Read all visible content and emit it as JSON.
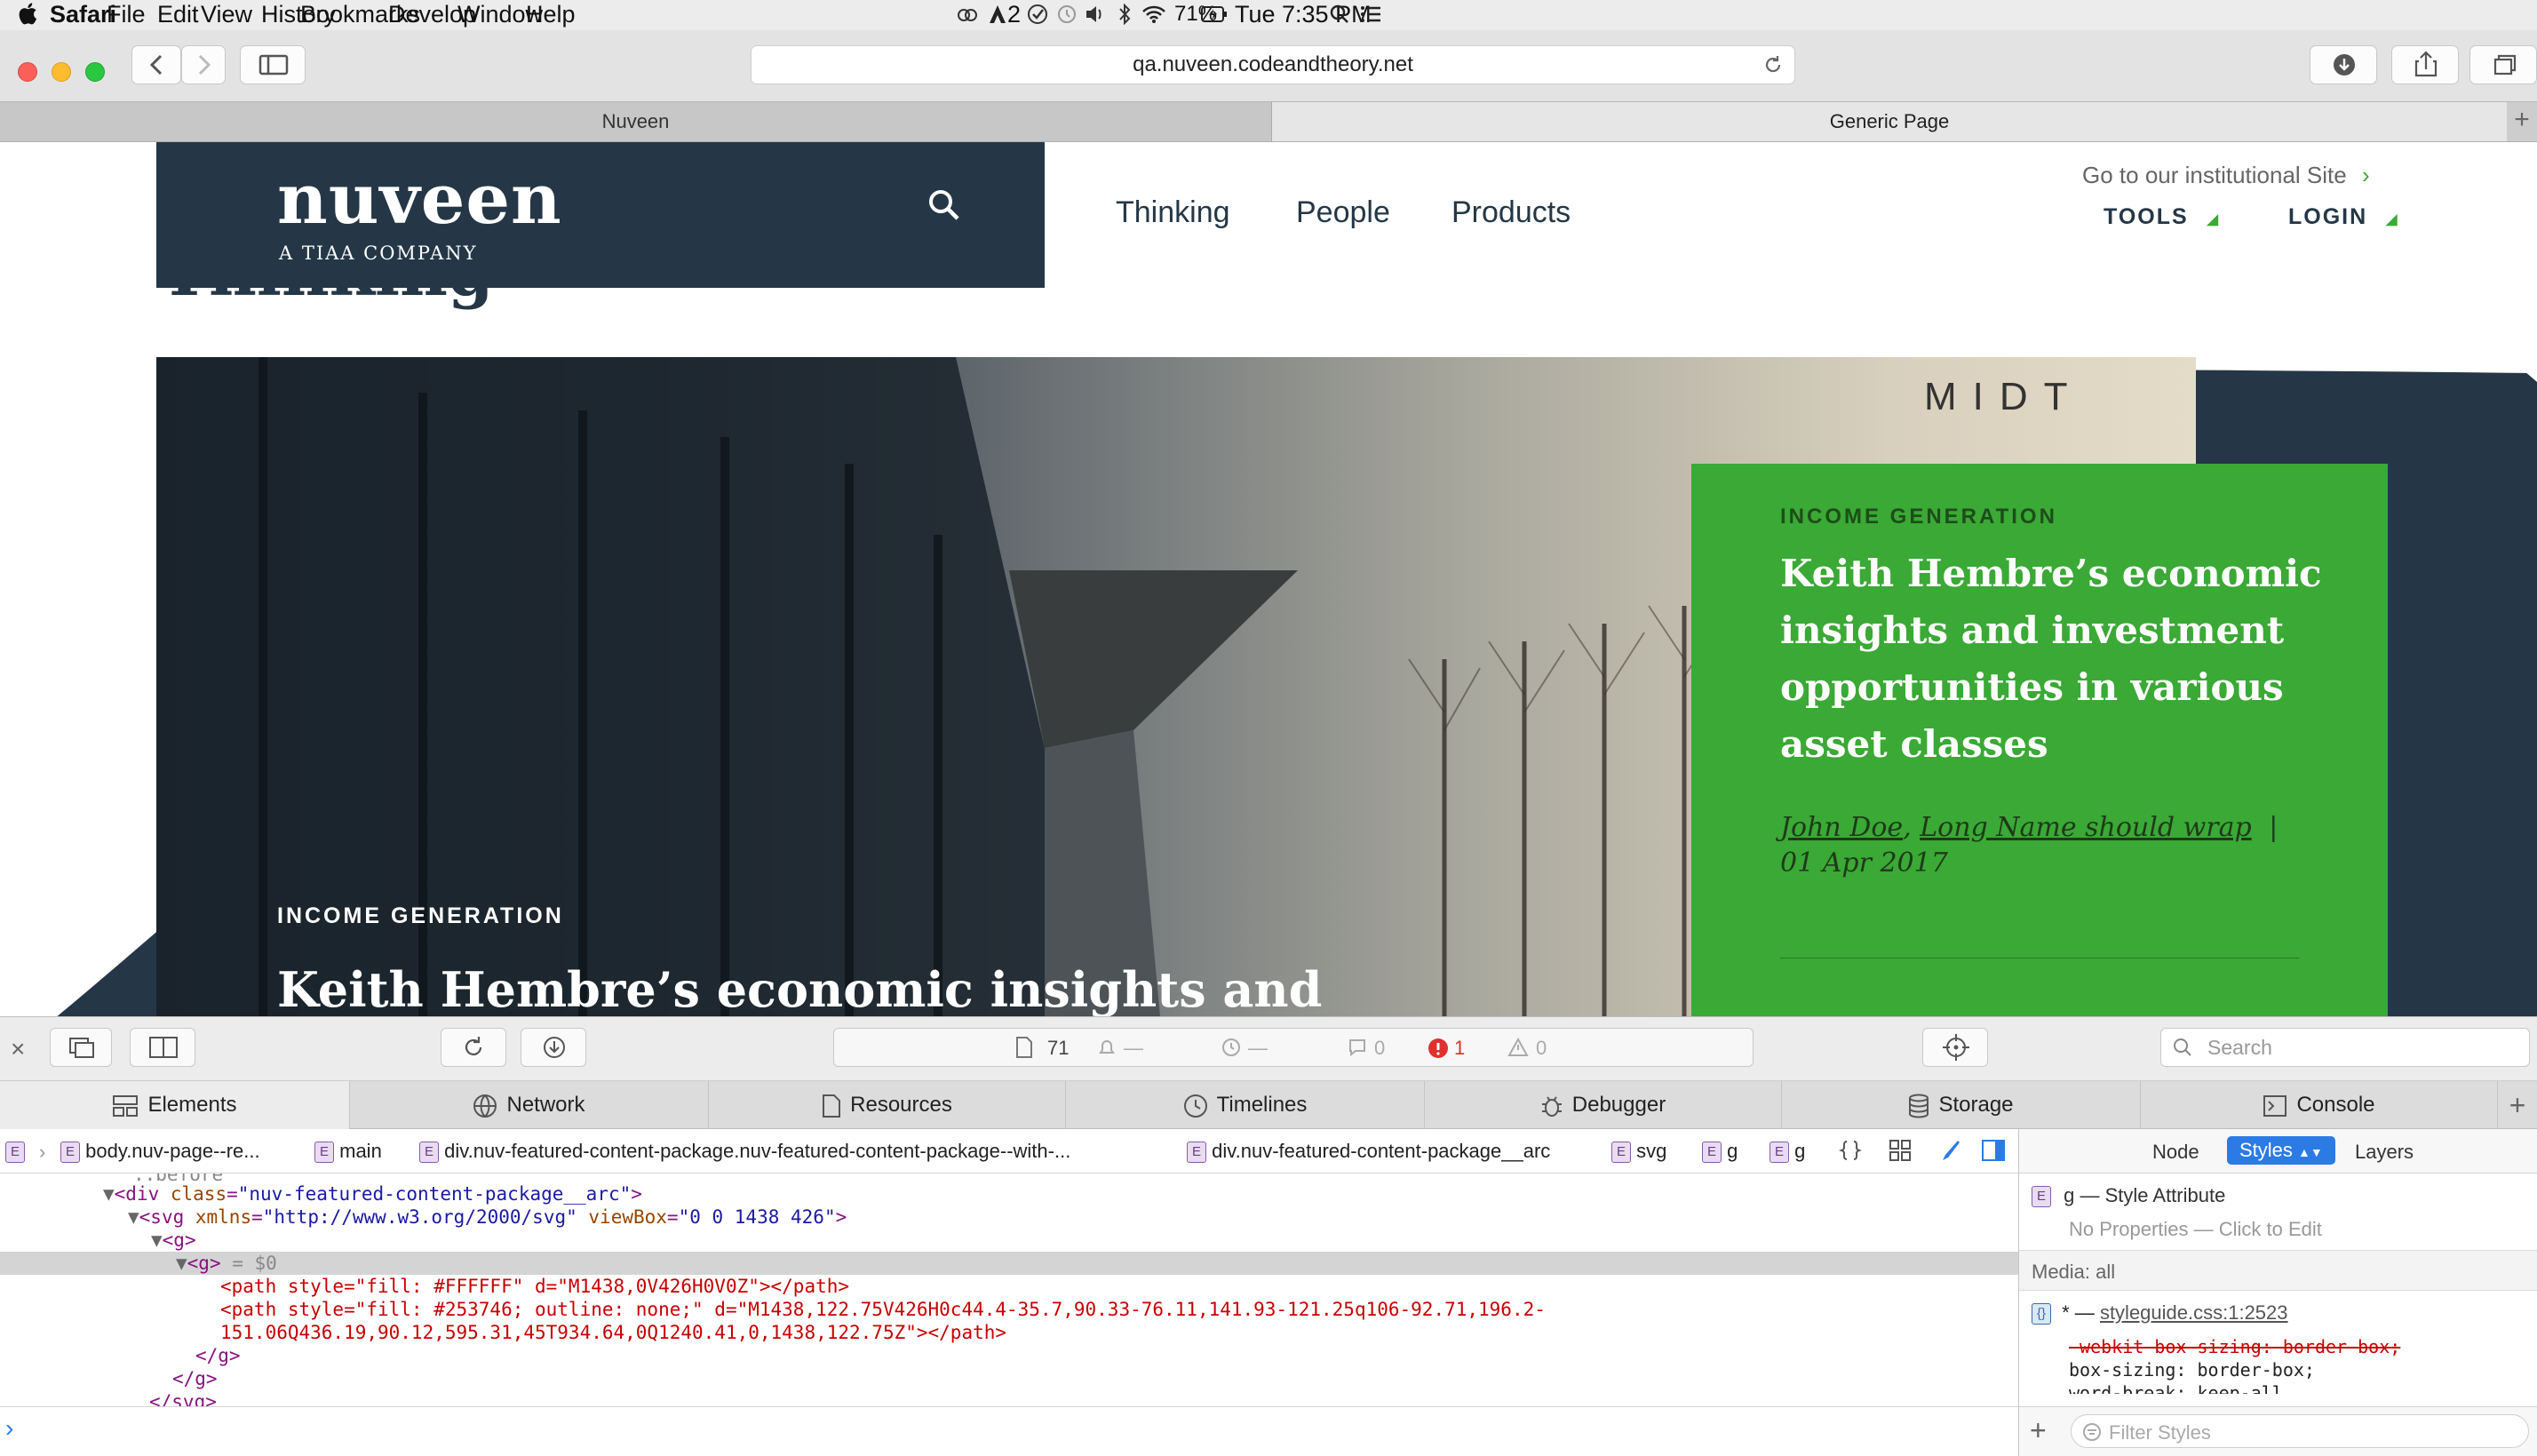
{
  "menubar": {
    "app": "Safari",
    "items": [
      "File",
      "Edit",
      "View",
      "History",
      "Bookmarks",
      "Develop",
      "Window",
      "Help"
    ],
    "status": {
      "adobe_count": "2",
      "battery": "71%",
      "clock": "Tue 7:35 PM"
    }
  },
  "browser": {
    "url": "qa.nuveen.codeandtheory.net",
    "tabs": [
      "Nuveen",
      "Generic Page"
    ]
  },
  "site": {
    "logo": "nuveen",
    "logo_tag": "A TIAA COMPANY",
    "nav": [
      "Thinking",
      "People",
      "Products"
    ],
    "institutional_link": "Go to our institutional Site",
    "tools": "TOOLS",
    "login": "LOGIN",
    "page_title_fragment": "Thinking",
    "hero_overlay_text": "MIDT",
    "hero": {
      "eyebrow": "INCOME GENERATION",
      "headline": "Keith Hembre’s economic insights and"
    },
    "card": {
      "eyebrow": "INCOME GENERATION",
      "headline": "Keith Hembre’s economic insights and investment opportunities in various asset classes",
      "author1": "John Doe",
      "author2": "Long Name should wrap",
      "separator": "|",
      "date": "01 Apr 2017"
    },
    "colors": {
      "navy": "#253746",
      "green": "#3aa935"
    }
  },
  "devtools": {
    "resources_count": "71",
    "dash1": "—",
    "dash2": "—",
    "messages": "0",
    "errors": "1",
    "warnings": "0",
    "search_placeholder": "Search",
    "tabs": [
      "Elements",
      "Network",
      "Resources",
      "Timelines",
      "Debugger",
      "Storage",
      "Console"
    ],
    "breadcrumbs": [
      "body.nuv-page--re...",
      "main",
      "div.nuv-featured-content-package.nuv-featured-content-package--with-...",
      "div.nuv-featured-content-package__arc",
      "svg",
      "g",
      "g"
    ],
    "code": {
      "l0": "::before",
      "l1_open": "<div ",
      "l1_attr": "class",
      "l1_val": "\"nuv-featured-content-package__arc\"",
      "l1_close": ">",
      "l2_open": "<svg ",
      "l2_attr1": "xmlns",
      "l2_val1": "\"http://www.w3.org/2000/svg\"",
      "l2_attr2": " viewBox",
      "l2_val2": "\"0 0 1438 426\"",
      "l2_close": ">",
      "l3": "<g>",
      "l4": "<g>",
      "l4_sel": " = $0",
      "l5": "<path style=\"fill: #FFFFFF\" d=\"M1438,0V426H0V0Z\"></path>",
      "l6": "<path style=\"fill: #253746; outline: none;\" d=\"M1438,122.75V426H0c44.4-35.7,90.33-76.11,141.93-121.25q106-92.71,196.2-",
      "l7": "151.06Q436.19,90.12,595.31,45T934.64,0Q1240.41,0,1438,122.75Z\"></path>",
      "l8": "</g>",
      "l9": "</g>",
      "l10": "</svg>"
    },
    "side": {
      "tabs": [
        "Node",
        "Styles",
        "Layers"
      ],
      "style_attr": "g — Style Attribute",
      "no_props": "No Properties — Click to Edit",
      "media": "Media: all",
      "rule_selector": "* —",
      "rule_source": "styleguide.css:1:2523",
      "decl1": "-webkit-box-sizing: border-box;",
      "decl2": "box-sizing: border-box;",
      "decl3": "word-break: keep-all",
      "filter_placeholder": "Filter Styles"
    }
  }
}
